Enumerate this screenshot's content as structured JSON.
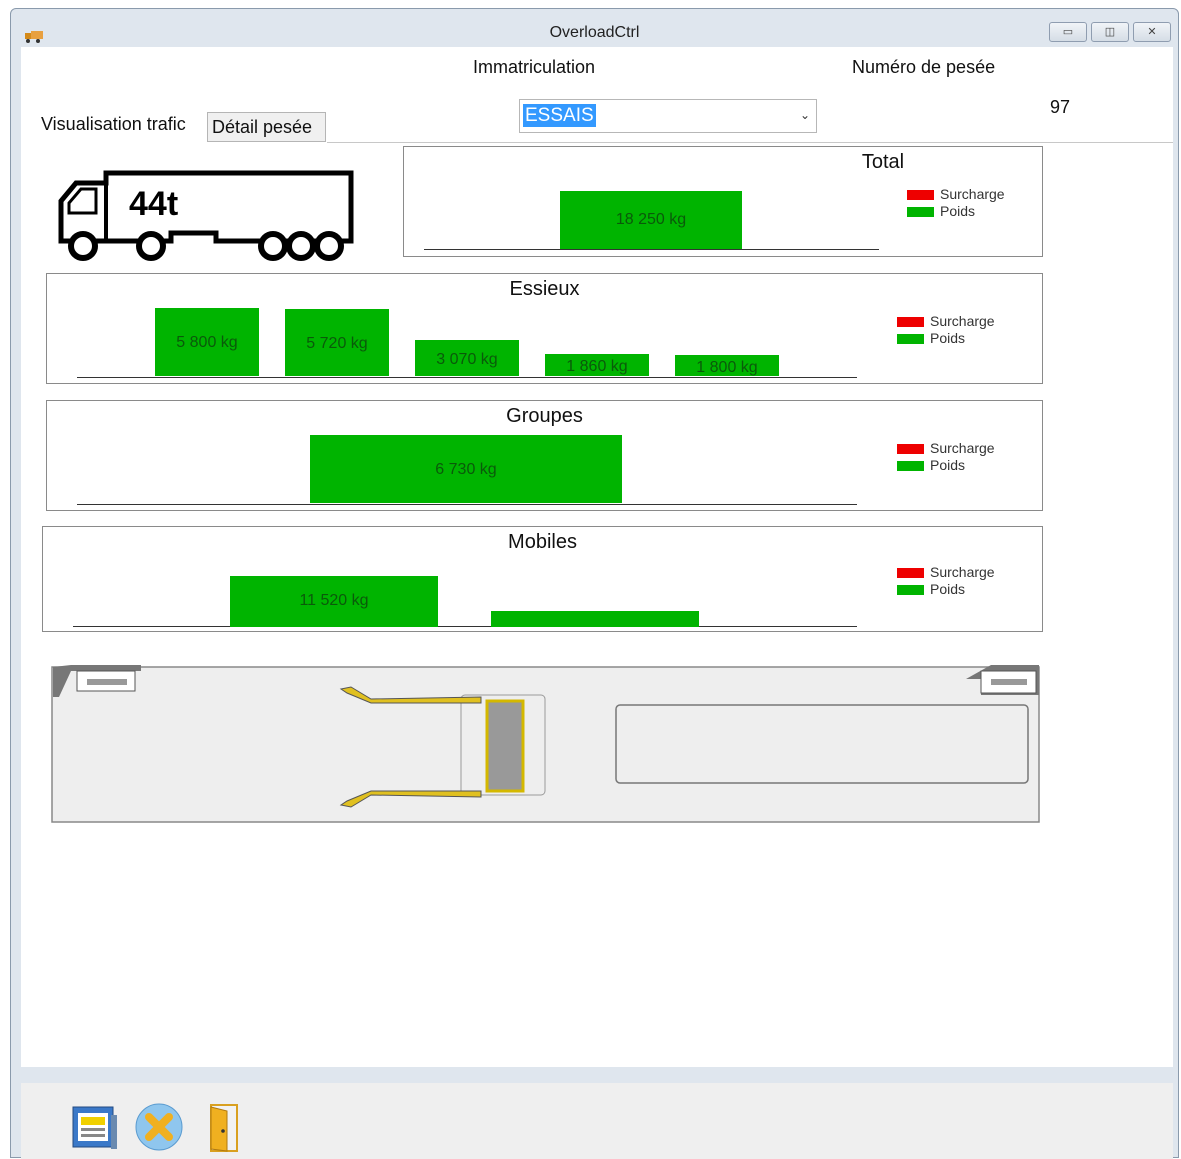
{
  "window": {
    "title": "OverloadCtrl",
    "controls": [
      "minimize",
      "maximize",
      "close"
    ]
  },
  "header": {
    "immatriculation_label": "Immatriculation",
    "immatriculation_value": "ESSAIS",
    "numero_label": "Numéro de pesée",
    "numero_value": "97"
  },
  "tabs": [
    {
      "label": "Visualisation trafic",
      "active": true
    },
    {
      "label": "Détail pesée",
      "active": false
    }
  ],
  "truck_icon": {
    "label": "44t"
  },
  "legend": {
    "surcharge": "Surcharge",
    "poids": "Poids",
    "surcharge_color": "#ee0000",
    "poids_color": "#00b400"
  },
  "panels": {
    "total": {
      "title": "Total",
      "bars": [
        {
          "value_kg": 18250,
          "label": "18 250 kg"
        }
      ]
    },
    "essieux": {
      "title": "Essieux",
      "bars": [
        {
          "value_kg": 5800,
          "label": "5 800 kg"
        },
        {
          "value_kg": 5720,
          "label": "5 720 kg"
        },
        {
          "value_kg": 3070,
          "label": "3 070 kg"
        },
        {
          "value_kg": 1860,
          "label": "1 860 kg"
        },
        {
          "value_kg": 1800,
          "label": "1 800 kg"
        }
      ]
    },
    "groupes": {
      "title": "Groupes",
      "bars": [
        {
          "value_kg": 6730,
          "label": "6 730 kg"
        }
      ]
    },
    "mobiles": {
      "title": "Mobiles",
      "bars": [
        {
          "value_kg": 11520,
          "label": "11 520 kg"
        },
        {
          "value_kg": null,
          "label": ""
        }
      ]
    }
  },
  "toolbar": {
    "buttons": [
      {
        "icon": "report-icon"
      },
      {
        "icon": "cancel-icon"
      },
      {
        "icon": "exit-door-icon"
      }
    ]
  }
}
